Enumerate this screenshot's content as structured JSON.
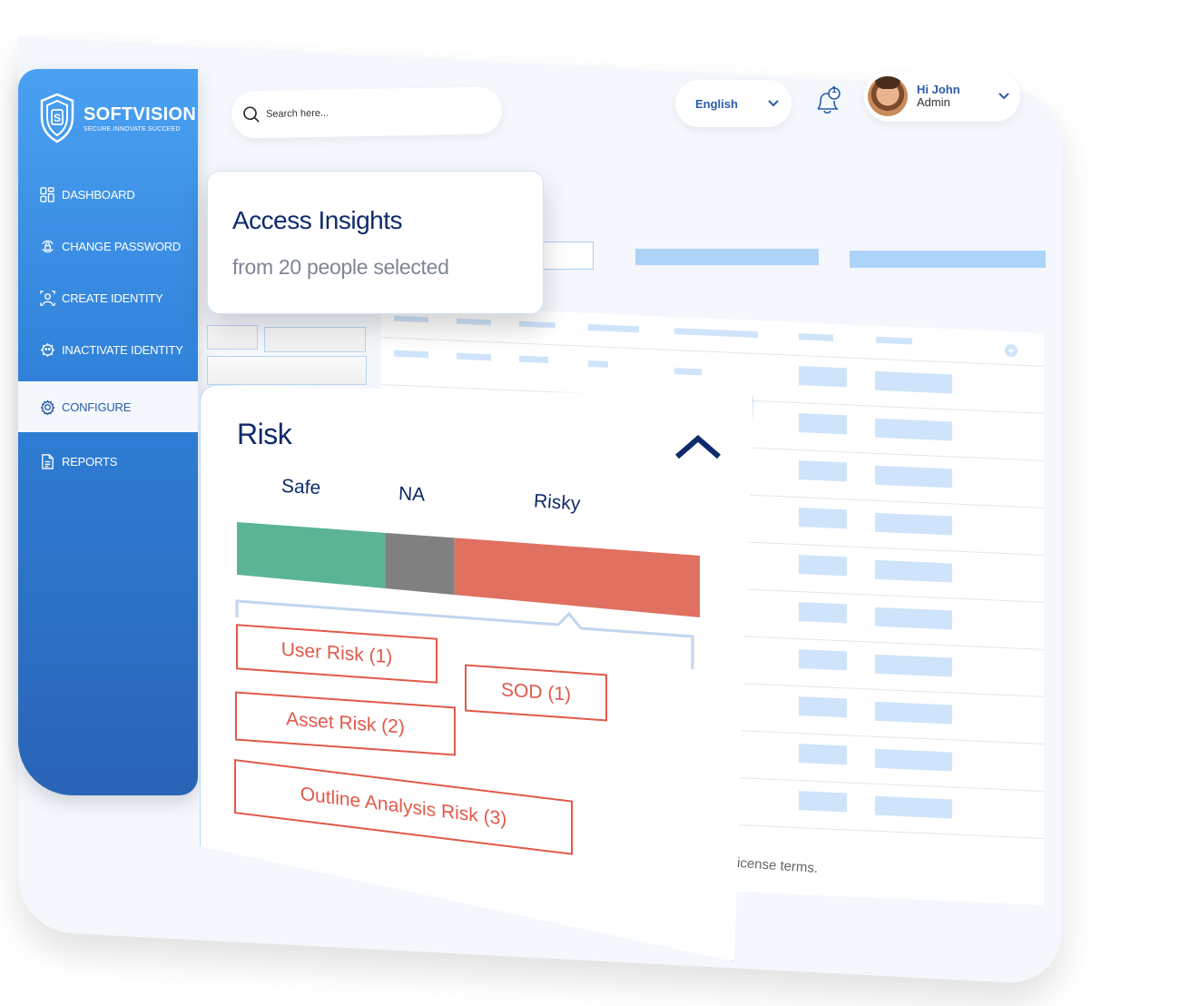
{
  "brand": {
    "name": "SOFTVISION",
    "tagline": "SECURE.INNOVATE.SUCCEED"
  },
  "sidebar": {
    "items": [
      {
        "label": "DASHBOARD",
        "icon": "dashboard-grid-icon",
        "active": false
      },
      {
        "label": "CHANGE PASSWORD",
        "icon": "lock-refresh-icon",
        "active": false
      },
      {
        "label": "CREATE IDENTITY",
        "icon": "user-scan-icon",
        "active": false
      },
      {
        "label": "INACTIVATE IDENTITY",
        "icon": "user-gear-icon",
        "active": false
      },
      {
        "label": "CONFIGURE",
        "icon": "gear-icon",
        "active": true
      },
      {
        "label": "REPORTS",
        "icon": "document-icon",
        "active": false
      }
    ]
  },
  "header": {
    "search": {
      "placeholder": "Search here...",
      "value": ""
    },
    "language": {
      "selected": "English"
    },
    "notifications": {
      "count": "1"
    },
    "user": {
      "greeting": "Hi John",
      "role": "Admin"
    }
  },
  "insights": {
    "title": "Access Insights",
    "subtitle": "from 20 people selected"
  },
  "risk": {
    "title": "Risk",
    "expanded": true,
    "segments": [
      {
        "label": "Safe",
        "fraction": 0.32,
        "color": "#5bb595"
      },
      {
        "label": "NA",
        "fraction": 0.15,
        "color": "#808080"
      },
      {
        "label": "Risky",
        "fraction": 0.53,
        "color": "#e07060"
      }
    ],
    "tags": [
      {
        "label": "User Risk (1)"
      },
      {
        "label": "SOD (1)"
      },
      {
        "label": "Asset Risk (2)"
      },
      {
        "label": "Outline Analysis Risk (3)"
      }
    ]
  },
  "footer": {
    "text": "icense terms."
  },
  "colors": {
    "primary": "#2f7fd7",
    "navy": "#0f2a6b",
    "risk_red": "#e0594a",
    "placeholder_blue": "#aed3f8"
  }
}
